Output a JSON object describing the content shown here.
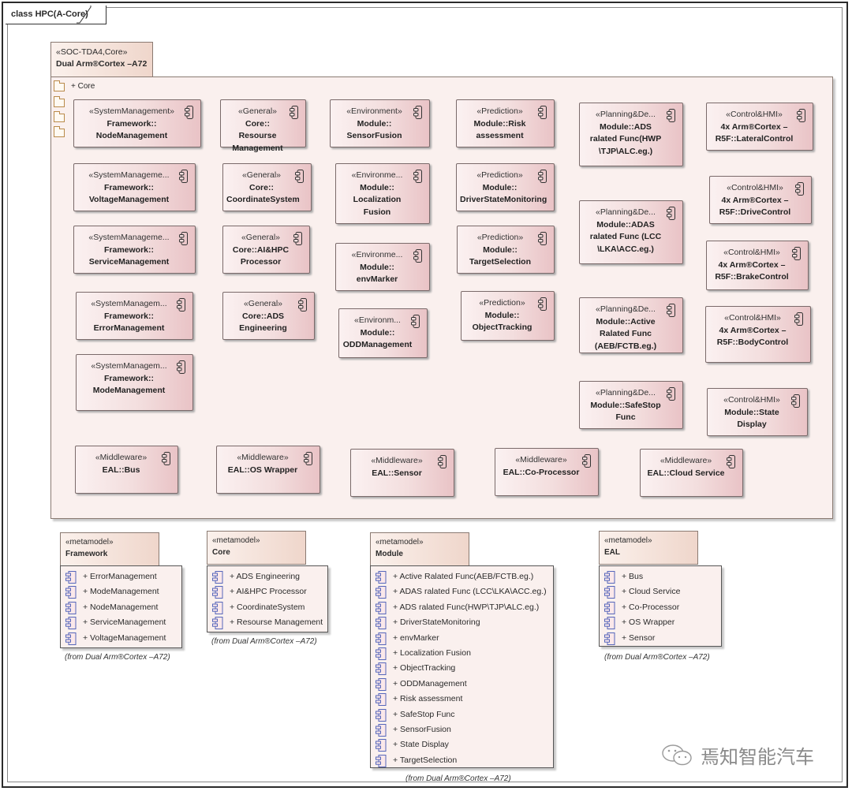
{
  "diagram": {
    "frame_label": "class HPC(A-Core)"
  },
  "package": {
    "stereotype": "«SOC-TDA4,Core»",
    "name": "Dual Arm®Cortex –A72",
    "folders": [
      "+ Core",
      "",
      "",
      ""
    ]
  },
  "components": [
    {
      "stereotype": "«SystemManagement»",
      "name": "Framework::\nNodeManagement"
    },
    {
      "stereotype": "«SystemManageme...",
      "name": "Framework::\nVoltageManagement"
    },
    {
      "stereotype": "«SystemManageme...",
      "name": "Framework::\nServiceManagement"
    },
    {
      "stereotype": "«SystemManagem...",
      "name": "Framework::\nErrorManagement"
    },
    {
      "stereotype": "«SystemManagem...",
      "name": "Framework::\nModeManagement"
    },
    {
      "stereotype": "«General»",
      "name": "Core::\nResourse\nManagement"
    },
    {
      "stereotype": "«General»",
      "name": "Core::\nCoordinateSystem"
    },
    {
      "stereotype": "«General»",
      "name": "Core::AI&HPC\nProcessor"
    },
    {
      "stereotype": "«General»",
      "name": "Core::ADS\nEngineering"
    },
    {
      "stereotype": "«Environment»",
      "name": "Module::\nSensorFusion"
    },
    {
      "stereotype": "«Environme...",
      "name": "Module::\nLocalization\nFusion"
    },
    {
      "stereotype": "«Environme...",
      "name": "Module::\nenvMarker"
    },
    {
      "stereotype": "«Environm...",
      "name": "Module::\nODDManagement"
    },
    {
      "stereotype": "«Prediction»",
      "name": "Module::Risk\nassessment"
    },
    {
      "stereotype": "«Prediction»",
      "name": "Module::\nDriverStateMonitoring"
    },
    {
      "stereotype": "«Prediction»",
      "name": "Module::\nTargetSelection"
    },
    {
      "stereotype": "«Prediction»",
      "name": "Module::\nObjectTracking"
    },
    {
      "stereotype": "«Planning&De...",
      "name": "Module::ADS\nralated Func(HWP\n\\TJP\\ALC.eg.)"
    },
    {
      "stereotype": "«Planning&De...",
      "name": "Module::ADAS\nralated Func (LCC\n\\LKA\\ACC.eg.)"
    },
    {
      "stereotype": "«Planning&De...",
      "name": "Module::Active\nRalated Func\n(AEB/FCTB.eg.)"
    },
    {
      "stereotype": "«Planning&De...",
      "name": "Module::SafeStop\nFunc"
    },
    {
      "stereotype": "«Control&HMI»",
      "name": "4x Arm®Cortex –\nR5F::LateralControl"
    },
    {
      "stereotype": "«Control&HMI»",
      "name": "4x Arm®Cortex –\nR5F::DriveControl"
    },
    {
      "stereotype": "«Control&HMI»",
      "name": "4x Arm®Cortex –\nR5F::BrakeControl"
    },
    {
      "stereotype": "«Control&HMI»",
      "name": "4x Arm®Cortex –\nR5F::BodyControl"
    },
    {
      "stereotype": "«Control&HMI»",
      "name": "Module::State\nDisplay"
    },
    {
      "stereotype": "«Middleware»",
      "name": "EAL::Bus"
    },
    {
      "stereotype": "«Middleware»",
      "name": "EAL::OS Wrapper"
    },
    {
      "stereotype": "«Middleware»",
      "name": "EAL::Sensor"
    },
    {
      "stereotype": "«Middleware»",
      "name": "EAL::Co-Processor"
    },
    {
      "stereotype": "«Middleware»",
      "name": "EAL::Cloud Service"
    }
  ],
  "metamodels": [
    {
      "stereotype": "«metamodel»",
      "name": "Framework",
      "items": [
        "+ ErrorManagement",
        "+ ModeManagement",
        "+ NodeManagement",
        "+ ServiceManagement",
        "+ VoltageManagement"
      ],
      "from": "(from Dual Arm®Cortex –A72)"
    },
    {
      "stereotype": "«metamodel»",
      "name": "Core",
      "items": [
        "+ ADS Engineering",
        "+ AI&HPC Processor",
        "+ CoordinateSystem",
        "+ Resourse Management"
      ],
      "from": "(from Dual Arm®Cortex –A72)"
    },
    {
      "stereotype": "«metamodel»",
      "name": "Module",
      "items": [
        "+ Active Ralated Func(AEB/FCTB.eg.)",
        "+ ADAS ralated Func (LCC\\LKA\\ACC.eg.)",
        "+ ADS ralated Func(HWP\\TJP\\ALC.eg.)",
        "+ DriverStateMonitoring",
        "+ envMarker",
        "+ Localization Fusion",
        "+ ObjectTracking",
        "+ ODDManagement",
        "+ Risk assessment",
        "+ SafeStop Func",
        "+ SensorFusion",
        "+ State Display",
        "+ TargetSelection"
      ],
      "from": "(from Dual Arm®Cortex –A72)"
    },
    {
      "stereotype": "«metamodel»",
      "name": "EAL",
      "items": [
        "+ Bus",
        "+ Cloud Service",
        "+ Co-Processor",
        "+ OS Wrapper",
        "+ Sensor"
      ],
      "from": "(from Dual Arm®Cortex –A72)"
    }
  ],
  "watermark": {
    "icon": "wechat-icon",
    "text": "焉知智能汽车"
  }
}
